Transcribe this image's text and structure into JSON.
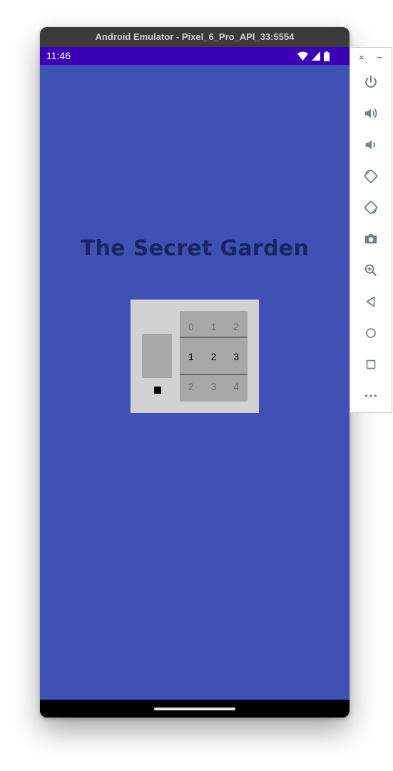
{
  "window": {
    "title": "Android Emulator - Pixel_6_Pro_API_33:5554"
  },
  "statusbar": {
    "time": "11:46"
  },
  "app": {
    "title": "The Secret Garden",
    "colors": {
      "background": "#3f51b5",
      "statusbar": "#3a00b8",
      "title": "#1b2560"
    },
    "lock": {
      "wheels_above": [
        "0",
        "1",
        "2"
      ],
      "wheels_selected": [
        "1",
        "2",
        "3"
      ],
      "wheels_below": [
        "2",
        "3",
        "4"
      ]
    }
  },
  "toolbar": {
    "close_glyph": "×",
    "minimize_glyph": "−",
    "buttons": [
      "power-icon",
      "volume-up-icon",
      "volume-down-icon",
      "rotate-left-icon",
      "rotate-right-icon",
      "camera-icon",
      "zoom-icon",
      "back-icon",
      "home-icon",
      "overview-icon",
      "more-icon"
    ]
  }
}
